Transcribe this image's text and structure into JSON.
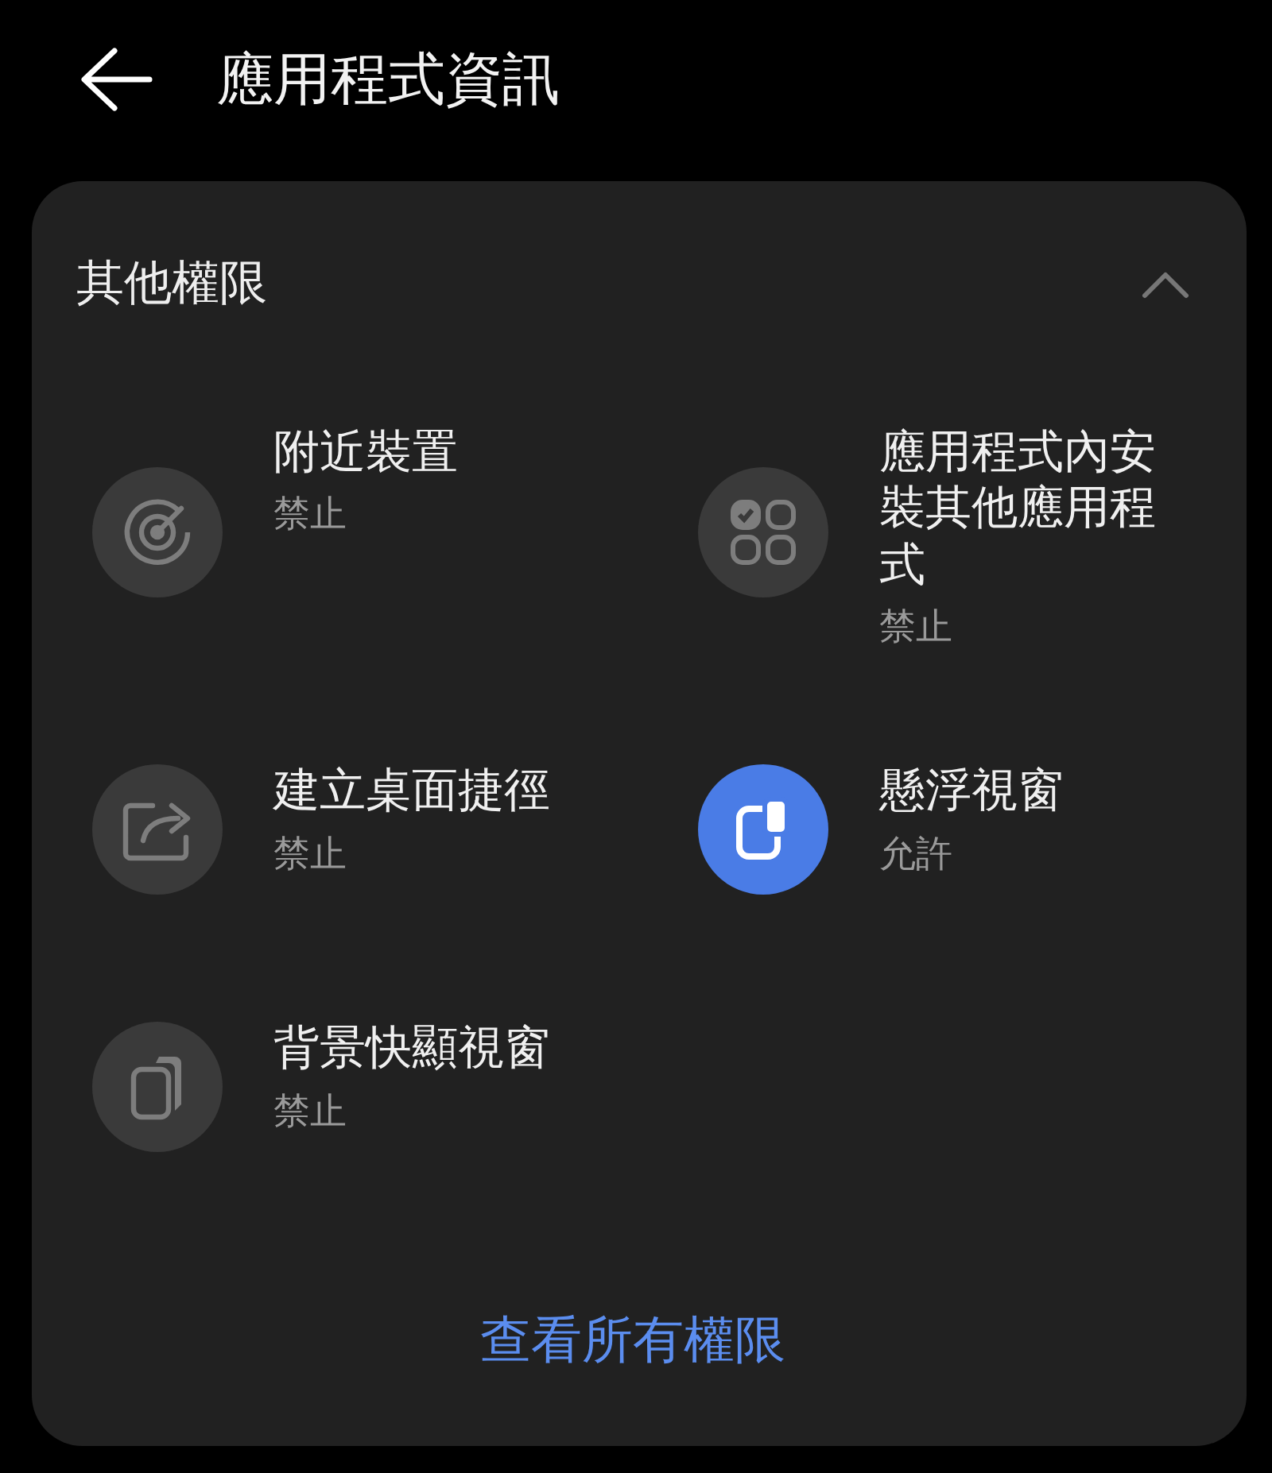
{
  "header": {
    "title": "應用程式資訊"
  },
  "card": {
    "title": "其他權限",
    "expanded": true,
    "permissions": [
      {
        "kind": "radar",
        "title": "附近裝置",
        "status": "禁止",
        "allowed": false
      },
      {
        "kind": "apps",
        "title": "應用程式內安裝其他應用程式",
        "status": "禁止",
        "allowed": false
      },
      {
        "kind": "shortcut",
        "title": "建立桌面捷徑",
        "status": "禁止",
        "allowed": false
      },
      {
        "kind": "floating",
        "title": "懸浮視窗",
        "status": "允許",
        "allowed": true
      },
      {
        "kind": "popup",
        "title": "背景快顯視窗",
        "status": "禁止",
        "allowed": false
      }
    ],
    "link": "查看所有權限"
  }
}
